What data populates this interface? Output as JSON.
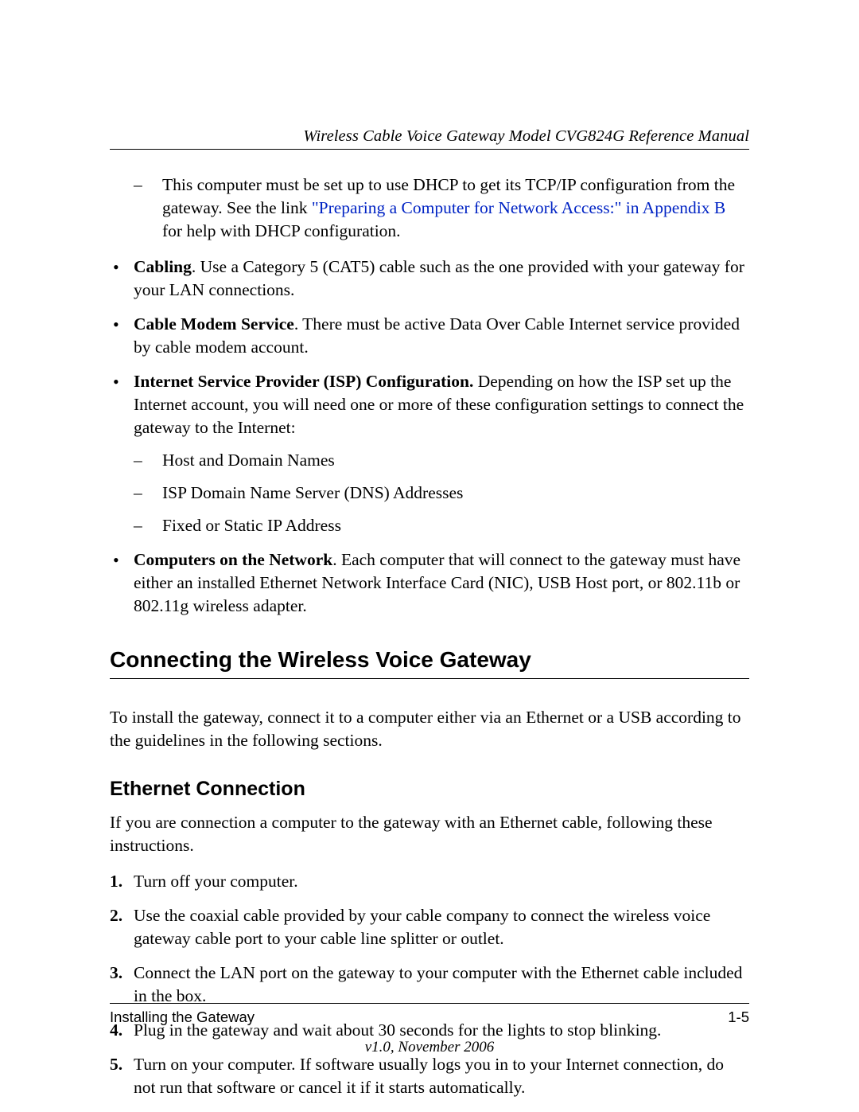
{
  "header": {
    "title": "Wireless Cable Voice Gateway Model CVG824G Reference Manual"
  },
  "intro_dash": {
    "pre": "This computer must be set up to use DHCP to get its TCP/IP configuration from the gateway. See the link ",
    "link": "\"Preparing a Computer for Network Access:\" in Appendix B",
    "post": " for help with DHCP configuration."
  },
  "bullets": [
    {
      "bold": "Cabling",
      "rest": ". Use a Category 5 (CAT5) cable such as the one provided with your gateway for your LAN connections."
    },
    {
      "bold": "Cable Modem Service",
      "rest": ". There must be active Data Over Cable Internet service provided by cable modem account."
    },
    {
      "bold": "Internet Service Provider (ISP) Configuration.",
      "rest": " Depending on how the ISP set up the Internet account, you will need one or more of these configuration settings to connect the gateway to the Internet:",
      "subs": [
        "Host and Domain Names",
        "ISP Domain Name Server (DNS) Addresses",
        "Fixed or Static IP Address"
      ]
    },
    {
      "bold": "Computers on the Network",
      "rest": ". Each computer that will connect to the gateway must have either an installed Ethernet Network Interface Card (NIC), USB Host port, or 802.11b or 802.11g wireless adapter."
    }
  ],
  "section": {
    "heading": "Connecting the Wireless Voice Gateway",
    "intro": "To install the gateway, connect it to a computer either via an Ethernet or a USB according to the guidelines in the following sections.",
    "sub_heading": "Ethernet Connection",
    "sub_intro": "If you are connection a computer to the gateway with an Ethernet cable, following these instructions.",
    "steps": [
      {
        "n": "1.",
        "t": "Turn off your computer."
      },
      {
        "n": "2.",
        "t": "Use the coaxial cable provided by your cable company to connect the wireless voice gateway cable port to your cable line splitter or outlet."
      },
      {
        "n": "3.",
        "t": "Connect the LAN port on the gateway to your computer with the Ethernet cable included in the box."
      },
      {
        "n": "4.",
        "t": "Plug in the gateway and wait about 30 seconds for the lights to stop blinking."
      },
      {
        "n": "5.",
        "t": "Turn on your computer. If software usually logs you in to your Internet connection, do not run that software or cancel it if it starts automatically."
      }
    ]
  },
  "footer": {
    "left": "Installing the Gateway",
    "right": "1-5",
    "version": "v1.0, November 2006"
  }
}
